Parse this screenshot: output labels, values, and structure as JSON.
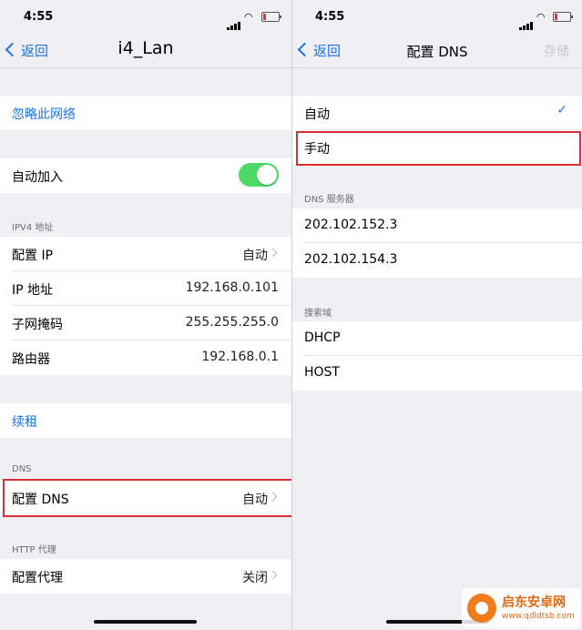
{
  "status": {
    "time_left": "4:55",
    "time_right": "4:55"
  },
  "left": {
    "back_label": "返回",
    "title": "i4_Lan",
    "forget_network": "忽略此网络",
    "auto_join": {
      "label": "自动加入",
      "on": true
    },
    "ipv4_header": "IPV4 地址",
    "configure_ip": {
      "label": "配置 IP",
      "value": "自动"
    },
    "ip_address": {
      "label": "IP 地址",
      "value": "192.168.0.101"
    },
    "subnet_mask": {
      "label": "子网掩码",
      "value": "255.255.255.0"
    },
    "router": {
      "label": "路由器",
      "value": "192.168.0.1"
    },
    "renew_lease": "续租",
    "dns_header": "DNS",
    "configure_dns": {
      "label": "配置 DNS",
      "value": "自动"
    },
    "http_proxy_header": "HTTP 代理",
    "configure_proxy": {
      "label": "配置代理",
      "value": "关闭"
    }
  },
  "right": {
    "back_label": "返回",
    "title": "配置 DNS",
    "save_label": "存储",
    "automatic": {
      "label": "自动",
      "checked": true
    },
    "manual": {
      "label": "手动"
    },
    "dns_servers_header": "DNS 服务器",
    "dns_servers": [
      "202.102.152.3",
      "202.102.154.3"
    ],
    "search_domains_header": "搜索域",
    "search_domains": [
      "DHCP",
      "HOST"
    ]
  },
  "watermark": {
    "line1": "启东安卓网",
    "line2": "www.qdldtsb.com"
  },
  "colors": {
    "accent": "#1a73e8",
    "toggle_on": "#4cd964",
    "highlight": "#d93033",
    "background": "#efeff4"
  }
}
